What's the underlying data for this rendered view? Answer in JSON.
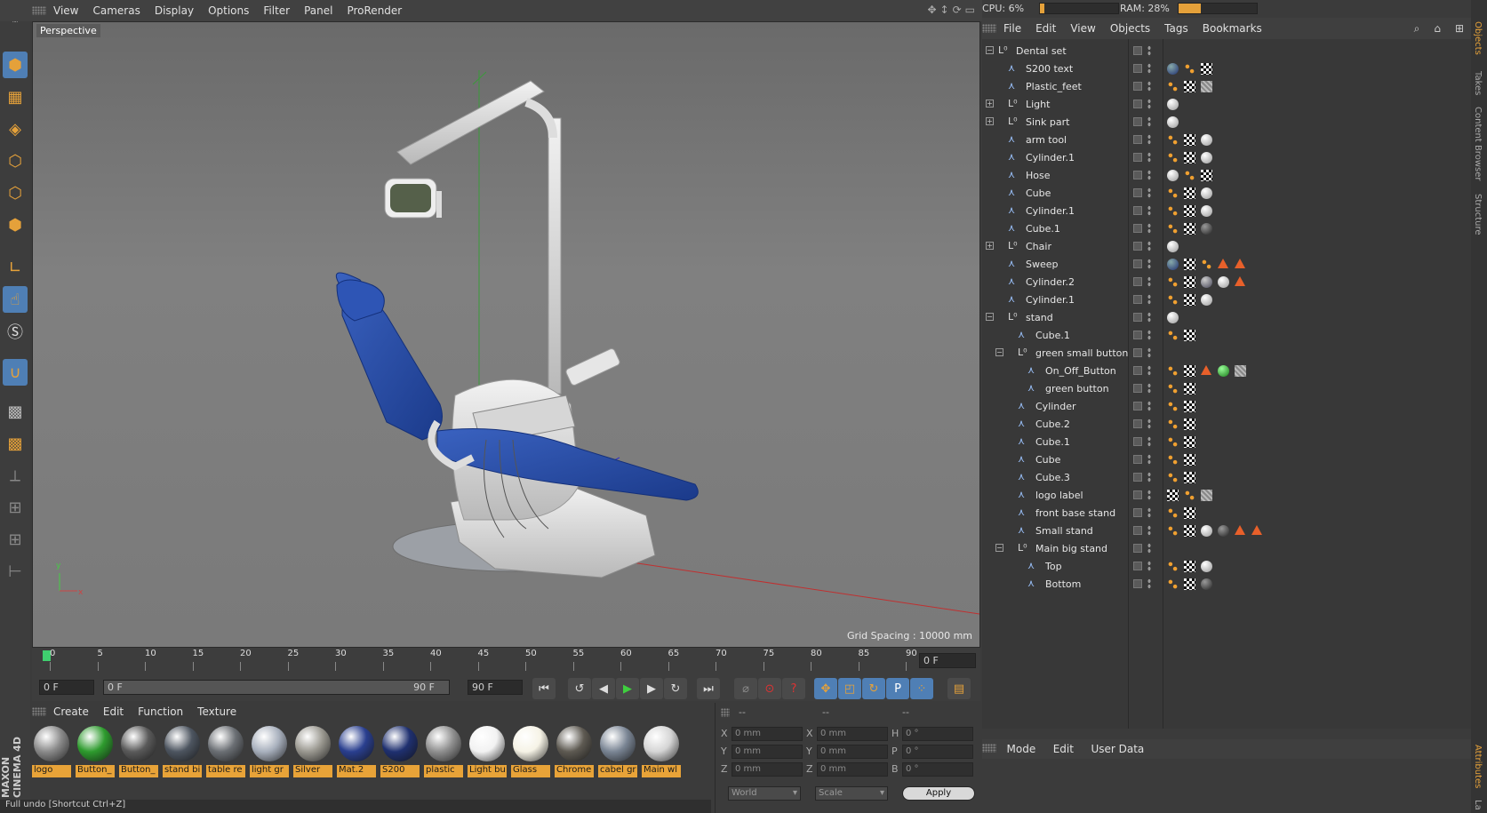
{
  "menu": [
    "View",
    "Cameras",
    "Display",
    "Options",
    "Filter",
    "Panel",
    "ProRender"
  ],
  "viewport": {
    "label": "Perspective",
    "grid_spacing": "Grid Spacing : 10000 mm"
  },
  "timeline": {
    "ticks": [
      "0",
      "5",
      "10",
      "15",
      "20",
      "25",
      "30",
      "35",
      "40",
      "45",
      "50",
      "55",
      "60",
      "65",
      "70",
      "75",
      "80",
      "85",
      "90"
    ],
    "current": "0 F",
    "start": "0 F",
    "range_start": "0 F",
    "range_end": "90 F",
    "end": "90 F"
  },
  "materials_menu": [
    "Create",
    "Edit",
    "Function",
    "Texture"
  ],
  "materials": [
    {
      "label": "logo",
      "color": "#8a8a8a"
    },
    {
      "label": "Button_",
      "color": "#2e9b2e"
    },
    {
      "label": "Button_",
      "color": "#5a5a5a"
    },
    {
      "label": "stand bi",
      "color": "#4d5560"
    },
    {
      "label": "table re",
      "color": "#6b6f74"
    },
    {
      "label": "light gr",
      "color": "#a8b0bd"
    },
    {
      "label": "Silver",
      "color": "#9a9890"
    },
    {
      "label": "Mat.2",
      "color": "#2a3f8f"
    },
    {
      "label": "S200",
      "color": "#1f3070"
    },
    {
      "label": "plastic",
      "color": "#8f8f8f"
    },
    {
      "label": "Light bu",
      "color": "#f2f2f2"
    },
    {
      "label": "Glass",
      "color": "#f6f3e6"
    },
    {
      "label": "Chrome",
      "color": "#5e5a52"
    },
    {
      "label": "cabel gr",
      "color": "#7a8594"
    },
    {
      "label": "Main wl",
      "color": "#d5d5d5"
    }
  ],
  "coords": {
    "headers": [
      "--",
      "--",
      "--"
    ],
    "rows": [
      {
        "a": "X",
        "av": "0 mm",
        "b": "X",
        "bv": "0 mm",
        "c": "H",
        "cv": "0 °"
      },
      {
        "a": "Y",
        "av": "0 mm",
        "b": "Y",
        "bv": "0 mm",
        "c": "P",
        "cv": "0 °"
      },
      {
        "a": "Z",
        "av": "0 mm",
        "b": "Z",
        "bv": "0 mm",
        "c": "B",
        "cv": "0 °"
      }
    ],
    "space": "World",
    "mode": "Scale",
    "apply": "Apply"
  },
  "perf": {
    "cpu": "CPU: 6%",
    "ram": "RAM: 28%"
  },
  "objects_menu": [
    "File",
    "Edit",
    "View",
    "Objects",
    "Tags",
    "Bookmarks"
  ],
  "objects": [
    {
      "name": "Dental set",
      "indent": 0,
      "type": "null",
      "tags": []
    },
    {
      "name": "S200 text",
      "indent": 1,
      "type": "obj",
      "tags": [
        "blue",
        "dots",
        "check"
      ]
    },
    {
      "name": "Plastic_feet",
      "indent": 1,
      "type": "obj",
      "tags": [
        "dots",
        "check",
        "stripe"
      ]
    },
    {
      "name": "Light",
      "indent": 1,
      "type": "null",
      "tags": [
        "white"
      ]
    },
    {
      "name": "Sink part",
      "indent": 1,
      "type": "null",
      "tags": [
        "white"
      ]
    },
    {
      "name": "arm tool",
      "indent": 1,
      "type": "obj",
      "tags": [
        "dots",
        "check",
        "white"
      ]
    },
    {
      "name": "Cylinder.1",
      "indent": 1,
      "type": "obj",
      "tags": [
        "dots",
        "check",
        "white"
      ]
    },
    {
      "name": "Hose",
      "indent": 1,
      "type": "obj",
      "tags": [
        "white",
        "dots",
        "check"
      ]
    },
    {
      "name": "Cube",
      "indent": 1,
      "type": "obj",
      "tags": [
        "dots",
        "check",
        "white"
      ]
    },
    {
      "name": "Cylinder.1",
      "indent": 1,
      "type": "obj",
      "tags": [
        "dots",
        "check",
        "white"
      ]
    },
    {
      "name": "Cube.1",
      "indent": 1,
      "type": "obj",
      "tags": [
        "dots",
        "check",
        "dark"
      ]
    },
    {
      "name": "Chair",
      "indent": 1,
      "type": "null",
      "tags": [
        "white"
      ]
    },
    {
      "name": "Sweep",
      "indent": 1,
      "type": "obj",
      "tags": [
        "blue",
        "check",
        "dots",
        "tri",
        "tri"
      ]
    },
    {
      "name": "Cylinder.2",
      "indent": 1,
      "type": "obj",
      "tags": [
        "dots",
        "check",
        "grey",
        "white",
        "tri"
      ]
    },
    {
      "name": "Cylinder.1",
      "indent": 1,
      "type": "obj",
      "tags": [
        "dots",
        "check",
        "white"
      ]
    },
    {
      "name": "stand",
      "indent": 1,
      "type": "null",
      "tags": [
        "white"
      ]
    },
    {
      "name": "Cube.1",
      "indent": 2,
      "type": "obj",
      "tags": [
        "dots",
        "check"
      ]
    },
    {
      "name": "green small button",
      "indent": 2,
      "type": "null",
      "tags": []
    },
    {
      "name": "On_Off_Button",
      "indent": 3,
      "type": "obj",
      "tags": [
        "dots",
        "check",
        "tri",
        "green",
        "stripe"
      ]
    },
    {
      "name": "green button",
      "indent": 3,
      "type": "obj",
      "tags": [
        "dots",
        "check"
      ]
    },
    {
      "name": "Cylinder",
      "indent": 2,
      "type": "obj",
      "tags": [
        "dots",
        "check"
      ]
    },
    {
      "name": "Cube.2",
      "indent": 2,
      "type": "obj",
      "tags": [
        "dots",
        "check"
      ]
    },
    {
      "name": "Cube.1",
      "indent": 2,
      "type": "obj",
      "tags": [
        "dots",
        "check"
      ]
    },
    {
      "name": "Cube",
      "indent": 2,
      "type": "obj",
      "tags": [
        "dots",
        "check"
      ]
    },
    {
      "name": "Cube.3",
      "indent": 2,
      "type": "obj",
      "tags": [
        "dots",
        "check"
      ]
    },
    {
      "name": "logo label",
      "indent": 2,
      "type": "obj",
      "tags": [
        "check",
        "dots",
        "stripe"
      ]
    },
    {
      "name": "front base stand",
      "indent": 2,
      "type": "obj",
      "tags": [
        "dots",
        "check"
      ]
    },
    {
      "name": "Small stand",
      "indent": 2,
      "type": "obj",
      "tags": [
        "dots",
        "check",
        "white",
        "dark",
        "tri",
        "tri"
      ]
    },
    {
      "name": "Main big stand",
      "indent": 2,
      "type": "null",
      "tags": []
    },
    {
      "name": "Top",
      "indent": 3,
      "type": "obj",
      "tags": [
        "dots",
        "check",
        "white"
      ]
    },
    {
      "name": "Bottom",
      "indent": 3,
      "type": "obj",
      "tags": [
        "dots",
        "check",
        "dark"
      ]
    }
  ],
  "attributes_menu": [
    "Mode",
    "Edit",
    "User Data"
  ],
  "side_tabs": [
    "Objects",
    "Takes",
    "Content Browser",
    "Structure"
  ],
  "side_tabs_bottom": [
    "Attributes",
    "La"
  ],
  "status_bar": "Full undo [Shortcut Ctrl+Z]",
  "brand": "MAXON CINEMA 4D"
}
